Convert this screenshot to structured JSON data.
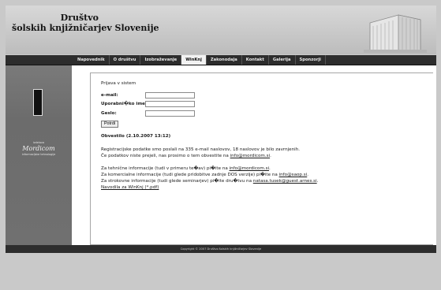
{
  "header": {
    "title_line1": "Društvo",
    "title_line2": "šolskih knjižničarjev Slovenije"
  },
  "nav": {
    "items": [
      {
        "label": "Napovednik",
        "active": false
      },
      {
        "label": "O društvu",
        "active": false
      },
      {
        "label": "Izobraževanje",
        "active": false
      },
      {
        "label": "WinKnj",
        "active": true
      },
      {
        "label": "Zakonodaja",
        "active": false
      },
      {
        "label": "Kontakt",
        "active": false
      },
      {
        "label": "Galerija",
        "active": false
      },
      {
        "label": "Sponzorji",
        "active": false
      }
    ]
  },
  "sidebar": {
    "caption": "izdelava",
    "logo": "Mordicom",
    "subcaption": "informacijske tehnologije"
  },
  "login": {
    "heading": "Prijava v sistem",
    "email_label": "e-mail:",
    "email_value": "",
    "username_label": "Uporabni�ko ime:",
    "username_value": "",
    "password_label": "Geslo:",
    "password_value": "",
    "submit_label": "Potrdi"
  },
  "notice": {
    "title": "Obvestilo (2.10.2007 13:12)",
    "para1_line1": "Registracijske podatke smo poslali na 335 e-mail naslovov, 18 naslovov je bilo zavrnjenih.",
    "para1_line2_prefix": "Če podatkov niste prejeli, nas prosimo o tem obvestite na ",
    "para1_line2_link": "info@mordicom.si",
    "para1_line2_suffix": ".",
    "para2_line1_prefix": "Za tehnične informacije (tudi v primeru te�av) pi�ite na ",
    "para2_line1_link": "info@mordicom.si",
    "para2_line1_suffix": ".",
    "para2_line2_prefix": "Za komercialne informacije (tudi glede pridobitve zadnje DOS verzije) pi�ite na ",
    "para2_line2_link": "info@saop.si",
    "para2_line2_suffix": ".",
    "para2_line3_prefix": "Za strokovne informacije (tudi glede seminarjev) pi�ite dru�tvu na ",
    "para2_line3_link": "natasa.tusek@guest.arnes.si",
    "para2_line3_suffix": ".",
    "manual_link": "Navodila za WinKnj (*.pdf)"
  },
  "footer": {
    "text": "Copyright © 2007 Društvo šolskih knjižničarjev Slovenije"
  }
}
